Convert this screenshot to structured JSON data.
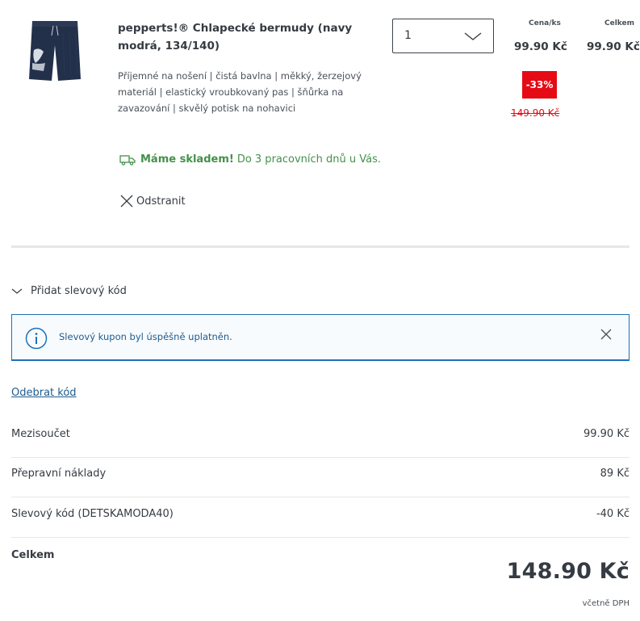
{
  "product": {
    "image_icon": "shorts-product-image",
    "title": "pepperts!® Chlapecké bermudy (navy modrá, 134/140)",
    "description": "Příjemné na nošení | čistá bavlna | měkký, žerzejový materiál | elastický vroubkovaný pas | šňůrka na zavazování | skvělý potisk na nohavici",
    "quantity": "1",
    "unit_price_label": "Cena/ks",
    "total_label": "Celkem",
    "unit_price": "99.90 Kč",
    "total_price": "99.90 Kč",
    "discount_badge": "-33%",
    "old_price": "149.90 Kč",
    "stock_strong": "Máme skladem!",
    "stock_rest": "Do 3 pracovních dnů u Vás.",
    "remove_label": "Odstranit"
  },
  "promo": {
    "toggle_label": "Přidat slevový kód",
    "info_message": "Slevový kupon byl úspěšně uplatněn.",
    "remove_code_label": "Odebrat kód"
  },
  "summary": {
    "rows": [
      {
        "label": "Mezisoučet",
        "value": "99.90 Kč"
      },
      {
        "label": "Přepravní náklady",
        "value": "89 Kč"
      },
      {
        "label": "Slevový kód (DETSKAMODA40)",
        "value": "-40 Kč"
      }
    ],
    "total_label": "Celkem",
    "total_value": "148.90 Kč",
    "vat_note": "včetně DPH"
  },
  "colors": {
    "text": "#353b42",
    "discount_red": "#e60a14",
    "stock_green": "#44904a",
    "info_blue": "#1e71b8",
    "link_blue": "#1e5b8e"
  }
}
